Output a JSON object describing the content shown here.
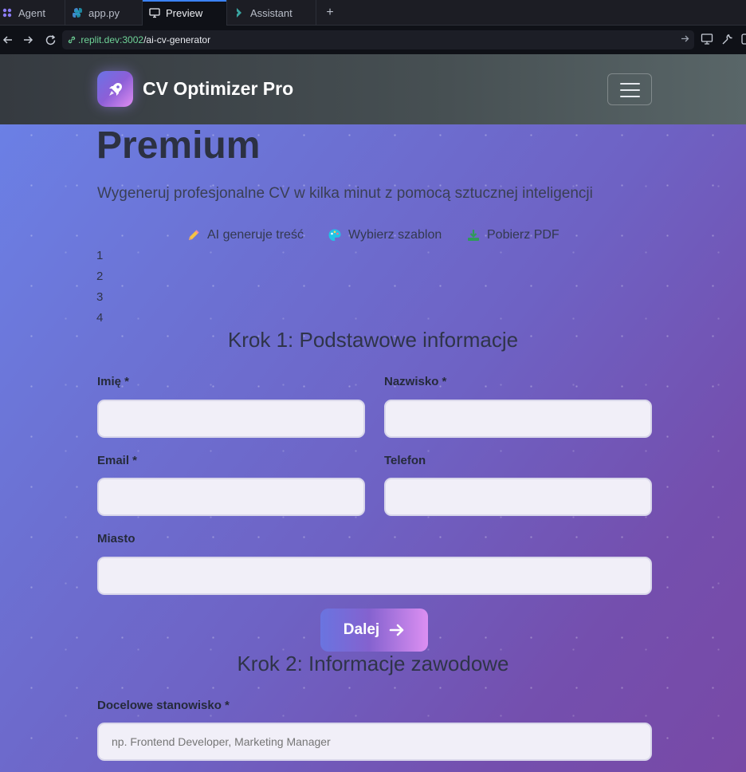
{
  "browser": {
    "tabs": [
      {
        "label": "Agent"
      },
      {
        "label": "app.py"
      },
      {
        "label": "Preview"
      },
      {
        "label": "Assistant"
      }
    ],
    "url_host": ".replit.dev:3002",
    "url_path": "/ai-cv-generator",
    "new_tab_glyph": "+"
  },
  "header": {
    "brand": "CV Optimizer Pro",
    "logo_icon": "rocket-icon",
    "menu_icon": "hamburger-menu-icon"
  },
  "hero": {
    "title": "Premium",
    "subtitle": "Wygeneruj profesjonalne CV w kilka minut z pomocą sztucznej inteligencji",
    "features": [
      {
        "icon": "pencil-icon",
        "label": "AI generuje treść"
      },
      {
        "icon": "palette-icon",
        "label": "Wybierz szablon"
      },
      {
        "icon": "download-icon",
        "label": "Pobierz PDF"
      }
    ]
  },
  "steps": [
    "1",
    "2",
    "3",
    "4"
  ],
  "step1": {
    "title": "Krok 1: Podstawowe informacje",
    "fields": {
      "first_name": {
        "label": "Imię *",
        "value": ""
      },
      "last_name": {
        "label": "Nazwisko *",
        "value": ""
      },
      "email": {
        "label": "Email *",
        "value": ""
      },
      "phone": {
        "label": "Telefon",
        "value": ""
      },
      "city": {
        "label": "Miasto",
        "value": ""
      }
    },
    "next_button": "Dalej",
    "next_icon": "arrow-right-icon"
  },
  "step2": {
    "title": "Krok 2: Informacje zawodowe",
    "fields": {
      "target_position": {
        "label": "Docelowe stanowisko *",
        "placeholder": "np. Frontend Developer, Marketing Manager"
      }
    }
  },
  "colors": {
    "accent_blue": "#3b82f6",
    "url_green": "#6fd397",
    "gradient_start": "#6b82e8",
    "gradient_end": "#7849a6",
    "button_pink": "#dc8ff2"
  }
}
